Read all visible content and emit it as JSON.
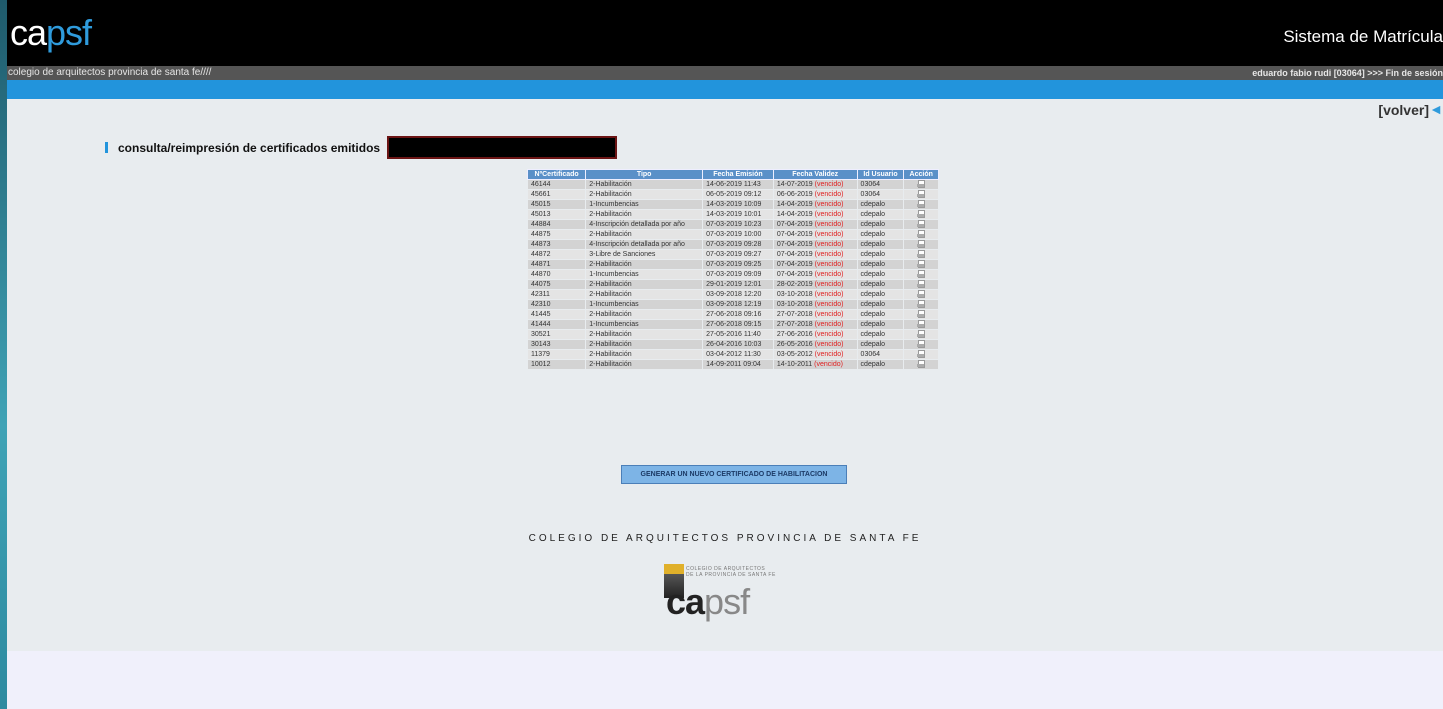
{
  "header": {
    "logo_ca": "ca",
    "logo_psf": "psf",
    "system_title": "Sistema de Matrícula",
    "tagline": "colegio de arquitectos provincia de santa fe////",
    "user_info": "eduardo fabio rudi [03064]  >>> Fin de sesión"
  },
  "nav": {
    "volver": "[volver]",
    "volver_arrow": "◄"
  },
  "section": {
    "title": "consulta/reimpresión de certificados emitidos"
  },
  "table": {
    "headers": [
      "NºCertificado",
      "Tipo",
      "Fecha Emisión",
      "Fecha Validez",
      "Id Usuario",
      "Acción"
    ],
    "rows": [
      {
        "num": "46144",
        "tipo": "2-Habilitación",
        "emision": "14-06-2019 11:43",
        "validez": "14-07-2019",
        "estado": "(vencido)",
        "usuario": "03064"
      },
      {
        "num": "45661",
        "tipo": "2-Habilitación",
        "emision": "06-05-2019 09:12",
        "validez": "06-06-2019",
        "estado": "(vencido)",
        "usuario": "03064"
      },
      {
        "num": "45015",
        "tipo": "1-Incumbencias",
        "emision": "14-03-2019 10:09",
        "validez": "14-04-2019",
        "estado": "(vencido)",
        "usuario": "cdepalo"
      },
      {
        "num": "45013",
        "tipo": "2-Habilitación",
        "emision": "14-03-2019 10:01",
        "validez": "14-04-2019",
        "estado": "(vencido)",
        "usuario": "cdepalo"
      },
      {
        "num": "44884",
        "tipo": "4-Inscripción detallada por año",
        "emision": "07-03-2019 10:23",
        "validez": "07-04-2019",
        "estado": "(vencido)",
        "usuario": "cdepalo"
      },
      {
        "num": "44875",
        "tipo": "2-Habilitación",
        "emision": "07-03-2019 10:00",
        "validez": "07-04-2019",
        "estado": "(vencido)",
        "usuario": "cdepalo"
      },
      {
        "num": "44873",
        "tipo": "4-Inscripción detallada por año",
        "emision": "07-03-2019 09:28",
        "validez": "07-04-2019",
        "estado": "(vencido)",
        "usuario": "cdepalo"
      },
      {
        "num": "44872",
        "tipo": "3-Libre de Sanciones",
        "emision": "07-03-2019 09:27",
        "validez": "07-04-2019",
        "estado": "(vencido)",
        "usuario": "cdepalo"
      },
      {
        "num": "44871",
        "tipo": "2-Habilitación",
        "emision": "07-03-2019 09:25",
        "validez": "07-04-2019",
        "estado": "(vencido)",
        "usuario": "cdepalo"
      },
      {
        "num": "44870",
        "tipo": "1-Incumbencias",
        "emision": "07-03-2019 09:09",
        "validez": "07-04-2019",
        "estado": "(vencido)",
        "usuario": "cdepalo"
      },
      {
        "num": "44075",
        "tipo": "2-Habilitación",
        "emision": "29-01-2019 12:01",
        "validez": "28-02-2019",
        "estado": "(vencido)",
        "usuario": "cdepalo"
      },
      {
        "num": "42311",
        "tipo": "2-Habilitación",
        "emision": "03-09-2018 12:20",
        "validez": "03-10-2018",
        "estado": "(vencido)",
        "usuario": "cdepalo"
      },
      {
        "num": "42310",
        "tipo": "1-Incumbencias",
        "emision": "03-09-2018 12:19",
        "validez": "03-10-2018",
        "estado": "(vencido)",
        "usuario": "cdepalo"
      },
      {
        "num": "41445",
        "tipo": "2-Habilitación",
        "emision": "27-06-2018 09:16",
        "validez": "27-07-2018",
        "estado": "(vencido)",
        "usuario": "cdepalo"
      },
      {
        "num": "41444",
        "tipo": "1-Incumbencias",
        "emision": "27-06-2018 09:15",
        "validez": "27-07-2018",
        "estado": "(vencido)",
        "usuario": "cdepalo"
      },
      {
        "num": "30521",
        "tipo": "2-Habilitación",
        "emision": "27-05-2016 11:40",
        "validez": "27-06-2016",
        "estado": "(vencido)",
        "usuario": "cdepalo"
      },
      {
        "num": "30143",
        "tipo": "2-Habilitación",
        "emision": "26-04-2016 10:03",
        "validez": "26-05-2016",
        "estado": "(vencido)",
        "usuario": "cdepalo"
      },
      {
        "num": "11379",
        "tipo": "2-Habilitación",
        "emision": "03-04-2012 11:30",
        "validez": "03-05-2012",
        "estado": "(vencido)",
        "usuario": "03064"
      },
      {
        "num": "10012",
        "tipo": "2-Habilitación",
        "emision": "14-09-2011 09:04",
        "validez": "14-10-2011",
        "estado": "(vencido)",
        "usuario": "cdepalo"
      }
    ]
  },
  "actions": {
    "generate": "GENERAR UN NUEVO CERTIFICADO DE HABILITACION"
  },
  "footer": {
    "title": "COLEGIO DE ARQUITECTOS PROVINCIA DE SANTA FE",
    "logo_small_1": "COLEGIO DE ARQUITECTOS",
    "logo_small_2": "DE LA PROVINCIA DE SANTA FE",
    "logo_ca": "ca",
    "logo_psf": "psf"
  },
  "colors": {
    "accent": "#2294dc",
    "table_header": "#5a90c8",
    "expired": "#e02020"
  }
}
